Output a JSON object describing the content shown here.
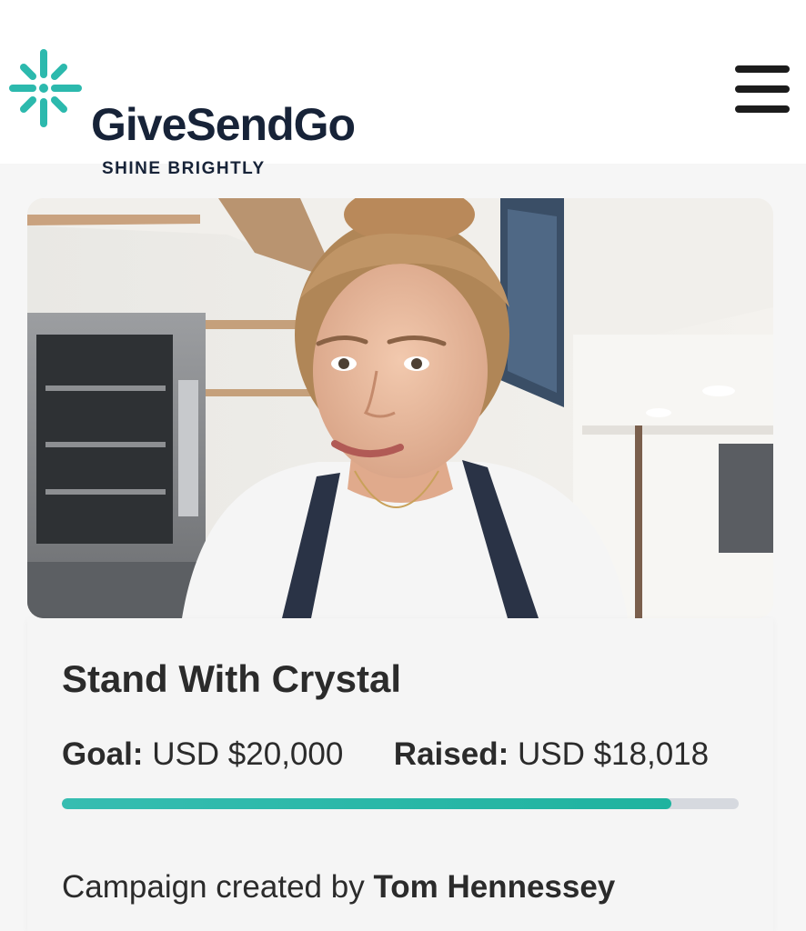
{
  "header": {
    "brand_name": "GiveSendGo",
    "tagline": "SHINE BRIGHTLY",
    "logo_icon": "sparkle-burst-icon",
    "menu_icon": "hamburger-menu-icon",
    "brand_color": "#2cb9ad",
    "text_color": "#172338"
  },
  "hero": {
    "image": "photo-of-woman-with-hair-bun-in-bakery-kitchen"
  },
  "campaign": {
    "title": "Stand With Crystal",
    "goal_label": "Goal:",
    "goal_value": "USD $20,000",
    "raised_label": "Raised:",
    "raised_value": "USD $18,018",
    "progress_percent": 90.09,
    "progress_color": "#25b6a6",
    "creator_prefix": "Campaign created by",
    "creator_name": "Tom Hennessey"
  }
}
